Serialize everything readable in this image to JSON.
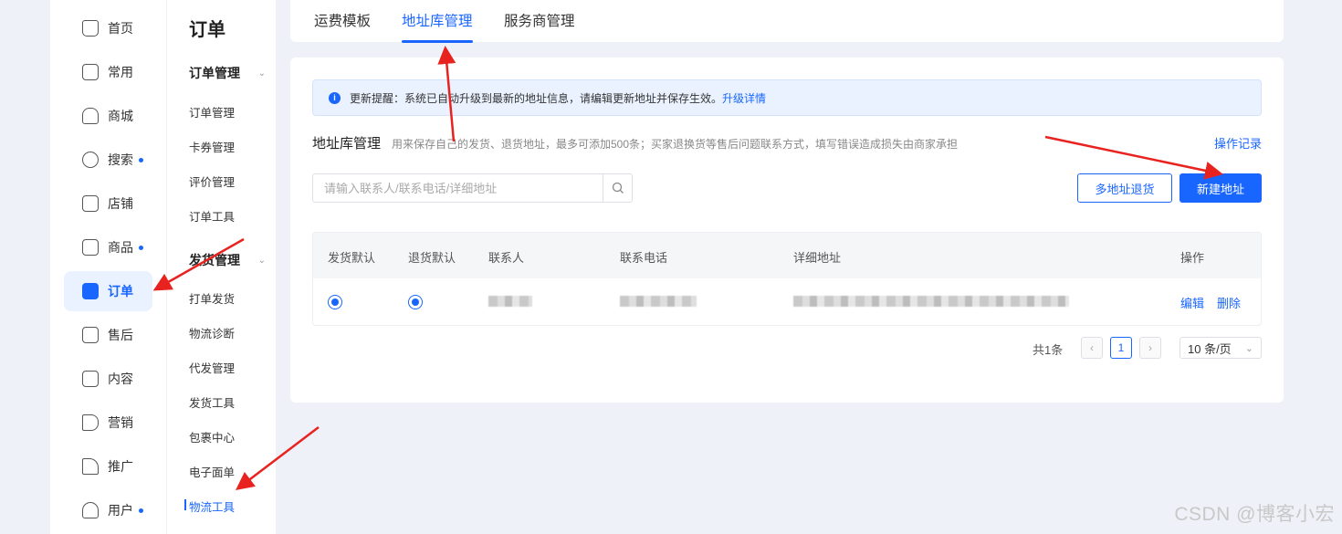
{
  "nav": {
    "items": [
      {
        "label": "首页",
        "icon": "home-icon",
        "dot": false
      },
      {
        "label": "常用",
        "icon": "folder-icon",
        "dot": false
      },
      {
        "label": "商城",
        "icon": "shop-icon",
        "dot": false
      },
      {
        "label": "搜索",
        "icon": "search-chart-icon",
        "dot": true
      },
      {
        "label": "店铺",
        "icon": "store-icon",
        "dot": false
      },
      {
        "label": "商品",
        "icon": "bag-icon",
        "dot": true
      },
      {
        "label": "订单",
        "icon": "order-icon",
        "dot": false,
        "active": true
      },
      {
        "label": "售后",
        "icon": "after-sales-icon",
        "dot": false
      },
      {
        "label": "内容",
        "icon": "tv-icon",
        "dot": false
      },
      {
        "label": "营销",
        "icon": "megaphone-icon",
        "dot": false
      },
      {
        "label": "推广",
        "icon": "send-icon",
        "dot": false
      },
      {
        "label": "用户",
        "icon": "user-icon",
        "dot": true
      }
    ]
  },
  "submenu": {
    "title": "订单",
    "groups": [
      {
        "label": "订单管理",
        "items": [
          "订单管理",
          "卡券管理",
          "评价管理",
          "订单工具"
        ]
      },
      {
        "label": "发货管理",
        "items": [
          "打单发货",
          "物流诊断",
          "代发管理",
          "发货工具",
          "包裹中心",
          "电子面单",
          "物流工具"
        ]
      }
    ],
    "active_item": "物流工具"
  },
  "tabs": [
    "运费模板",
    "地址库管理",
    "服务商管理"
  ],
  "active_tab": "地址库管理",
  "notice": {
    "text": "更新提醒：系统已自动升级到最新的地址信息，请编辑更新地址并保存生效。",
    "link": "升级详情"
  },
  "section": {
    "title": "地址库管理",
    "desc": "用来保存自己的发货、退货地址，最多可添加500条；买家退换货等售后问题联系方式，填写错误造成损失由商家承担",
    "oplog": "操作记录"
  },
  "search": {
    "placeholder": "请输入联系人/联系电话/详细地址",
    "value": ""
  },
  "buttons": {
    "multi_return": "多地址退货",
    "new_address": "新建地址"
  },
  "table": {
    "columns": [
      "发货默认",
      "退货默认",
      "联系人",
      "联系电话",
      "详细地址",
      "操作"
    ],
    "rows": [
      {
        "ship_default": true,
        "return_default": true,
        "contact": "",
        "phone": "",
        "address": "",
        "actions": [
          "编辑",
          "删除"
        ]
      }
    ]
  },
  "pagination": {
    "total": "共1条",
    "current": "1",
    "page_size": "10 条/页"
  },
  "watermark": "CSDN @博客小宏",
  "colors": {
    "accent": "#1966ff",
    "annotation": "#e8231f"
  }
}
